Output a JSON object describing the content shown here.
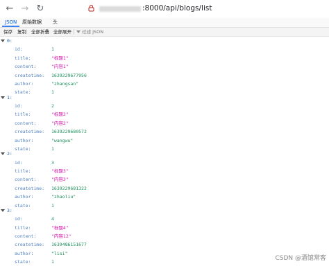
{
  "browser": {
    "back_icon": "←",
    "forward_icon": "→",
    "reload_icon": "↻",
    "url": ":8000/api/blogs/list"
  },
  "viewer": {
    "tabs": [
      "JSON",
      "原始数据",
      "头"
    ],
    "actions": [
      "保存",
      "复制",
      "全部折叠",
      "全部展开"
    ],
    "filter_label": "过滤 JSON"
  },
  "json": {
    "items": [
      {
        "index": "0:",
        "id": "1",
        "title": "\"标题1\"",
        "content": "\"内容1\"",
        "createtime": "1639229677956",
        "author": "\"zhangsan\"",
        "state": "1"
      },
      {
        "index": "1:",
        "id": "2",
        "title": "\"标题2\"",
        "content": "\"内容2\"",
        "createtime": "1639229680572",
        "author": "\"wangwu\"",
        "state": "1"
      },
      {
        "index": "2:",
        "id": "3",
        "title": "\"标题3\"",
        "content": "\"内容3\"",
        "createtime": "1639229681322",
        "author": "\"zhaoliu\"",
        "state": "1"
      },
      {
        "index": "3:",
        "id": "4",
        "title": "\"标题4\"",
        "content": "\"内容12\"",
        "createtime": "1639486151677",
        "author": "\"lisi\"",
        "state": "1"
      }
    ],
    "keys": {
      "id": "id:",
      "title": "title:",
      "content": "content:",
      "createtime": "createtime:",
      "author": "author:",
      "state": "state:"
    }
  },
  "watermark": "CSDN @酒馆常客"
}
